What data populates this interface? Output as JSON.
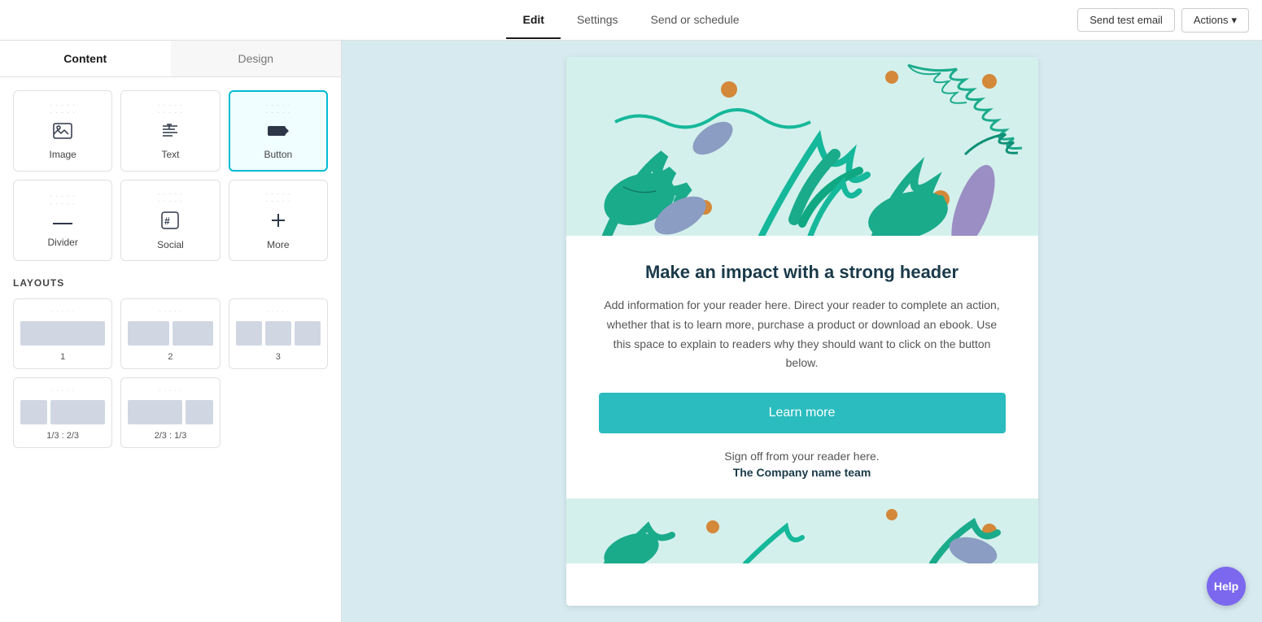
{
  "header": {
    "tabs": [
      {
        "label": "Edit",
        "active": true
      },
      {
        "label": "Settings",
        "active": false
      },
      {
        "label": "Send or schedule",
        "active": false
      }
    ],
    "send_test_email": "Send test email",
    "actions": "Actions"
  },
  "sidebar": {
    "content_tab": "Content",
    "design_tab": "Design",
    "blocks": [
      {
        "id": "image",
        "label": "Image",
        "icon": "image"
      },
      {
        "id": "text",
        "label": "Text",
        "icon": "text"
      },
      {
        "id": "button",
        "label": "Button",
        "icon": "button",
        "selected": true
      },
      {
        "id": "divider",
        "label": "Divider",
        "icon": "divider"
      },
      {
        "id": "social",
        "label": "Social",
        "icon": "social"
      },
      {
        "id": "more",
        "label": "More",
        "icon": "more"
      }
    ],
    "layouts_label": "LAYOUTS",
    "layouts": [
      {
        "id": "1",
        "label": "1",
        "cols": [
          1
        ]
      },
      {
        "id": "2",
        "label": "2",
        "cols": [
          0.5,
          0.5
        ]
      },
      {
        "id": "3",
        "label": "3",
        "cols": [
          0.33,
          0.33,
          0.33
        ]
      },
      {
        "id": "1/3-2/3",
        "label": "1/3 : 2/3",
        "cols": [
          0.33,
          0.67
        ]
      },
      {
        "id": "2/3-1/3",
        "label": "2/3 : 1/3",
        "cols": [
          0.67,
          0.33
        ]
      }
    ]
  },
  "email": {
    "heading": "Make an impact with a strong header",
    "body_text": "Add information for your reader here. Direct your reader to complete an action, whether that is to learn more, purchase a product or download an ebook. Use this space to explain to readers why they should want to click on the button below.",
    "cta_label": "Learn more",
    "signoff": "Sign off from your reader here.",
    "company": "The Company name team"
  },
  "help_button": "Help"
}
